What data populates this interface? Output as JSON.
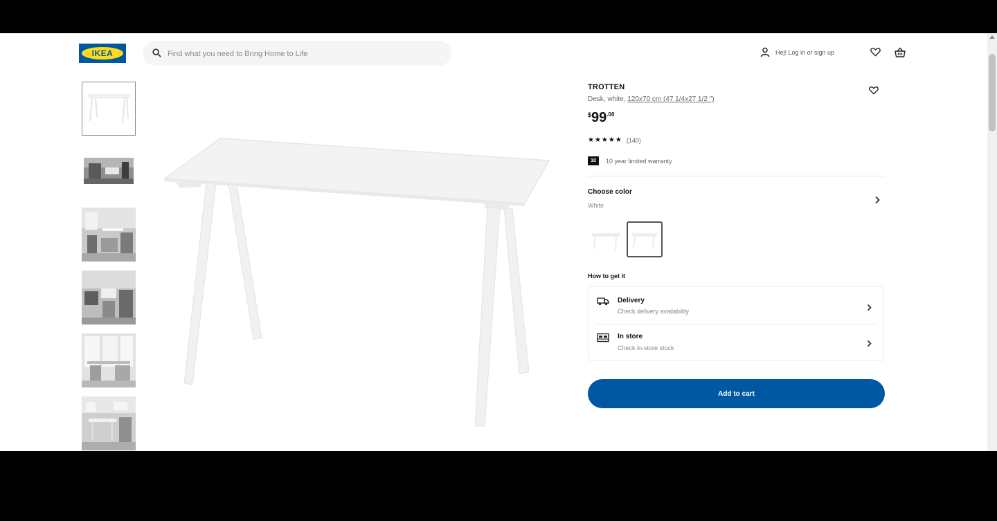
{
  "header": {
    "logo_text": "IKEA",
    "search_placeholder": "Find what you need to Bring Home to Life",
    "login_label": "Hej! Log in or sign up"
  },
  "product": {
    "name": "TROTTEN",
    "desc_prefix": "Desk, white, ",
    "desc_size": "120x70 cm (47 1/4x27 1/2 \")",
    "price_currency": "$",
    "price_int": "99",
    "price_dec": ".00",
    "stars": "★★★★★",
    "rating_count": "(140)",
    "warranty_badge": "10",
    "warranty_text": "10 year limited warranty",
    "choose_color_label": "Choose color",
    "selected_color": "White",
    "how_to_get_label": "How to get it",
    "delivery_title": "Delivery",
    "delivery_sub": "Check delivery availability",
    "store_title": "In store",
    "store_sub": "Check in-store stock",
    "add_to_cart_label": "Add to cart"
  },
  "colors": {
    "brand_blue": "#0058a3",
    "brand_yellow": "#ffda1a"
  },
  "thumbnails": [
    "desk-white",
    "workspace",
    "living-room-1",
    "living-room-2",
    "bright-room",
    "kids-room"
  ]
}
